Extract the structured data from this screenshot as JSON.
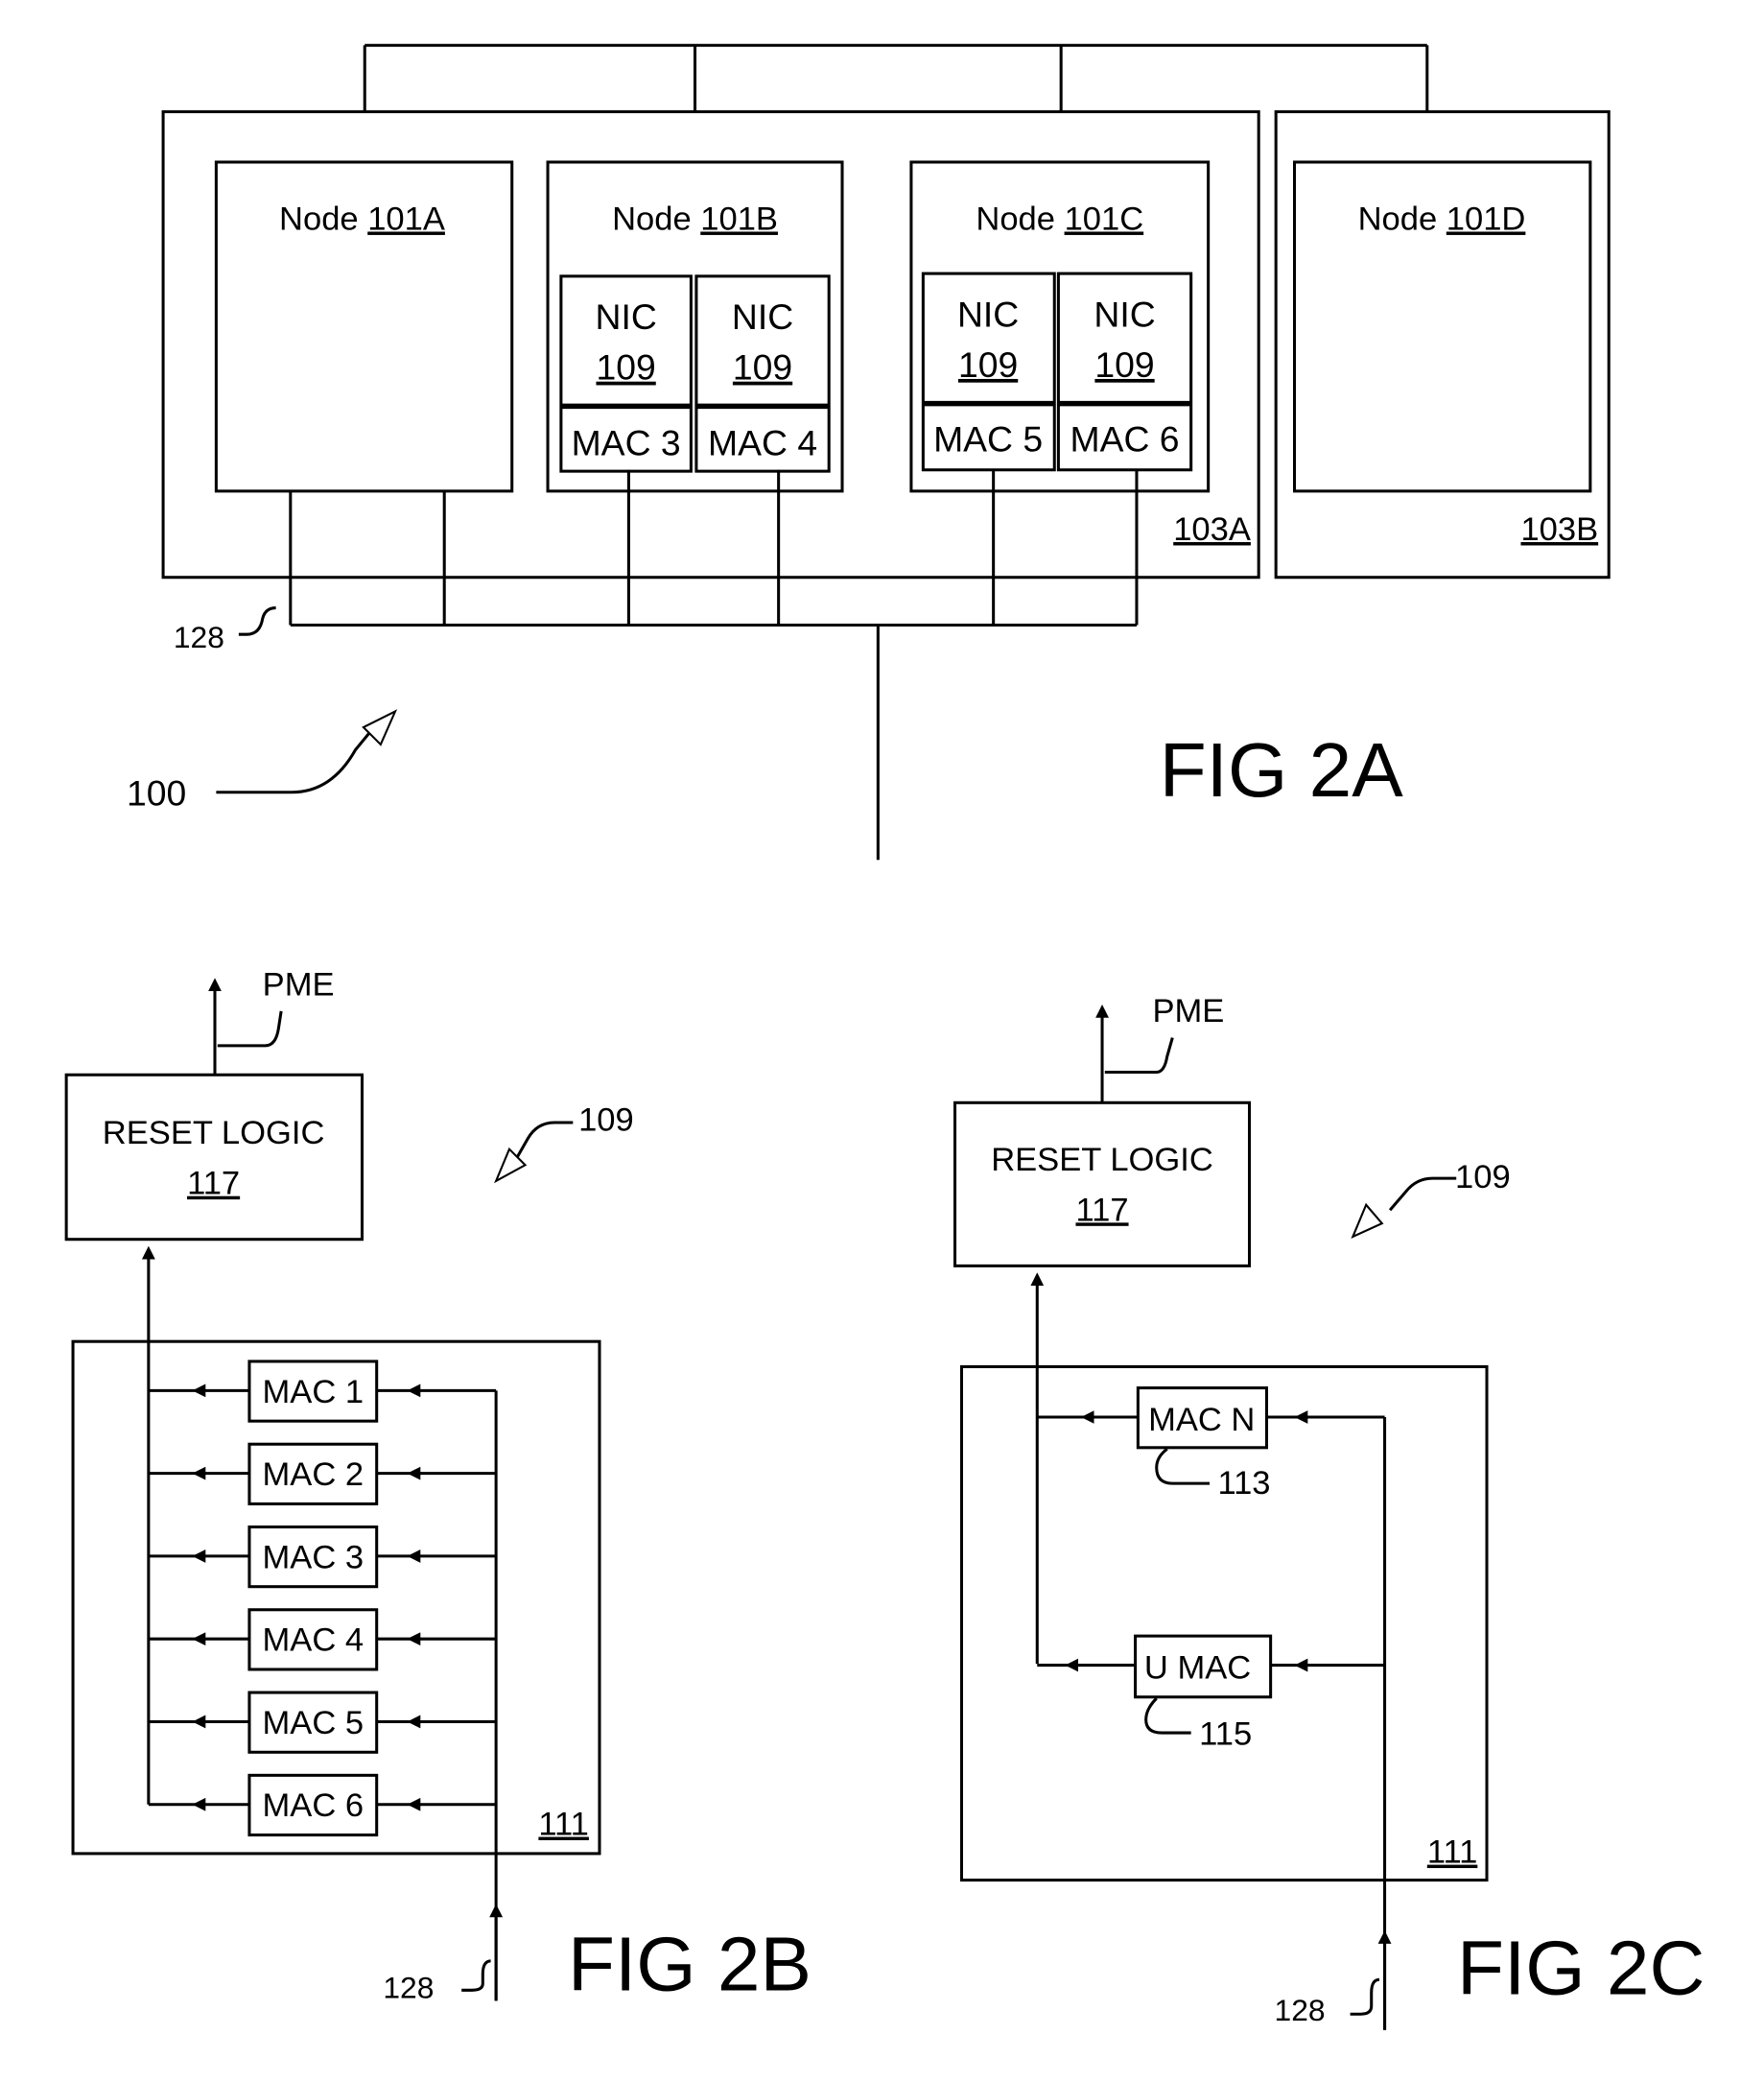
{
  "fig2a": {
    "title": "FIG 2A",
    "system_ref": "100",
    "bus_ref": "128",
    "enclosures": [
      {
        "label": "103A"
      },
      {
        "label": "103B"
      }
    ],
    "nodes": [
      {
        "prefix": "Node ",
        "ref": "101A"
      },
      {
        "prefix": "Node ",
        "ref": "101B"
      },
      {
        "prefix": "Node ",
        "ref": "101C"
      },
      {
        "prefix": "Node ",
        "ref": "101D"
      }
    ],
    "nics": [
      {
        "name": "NIC",
        "ref": "109",
        "mac": "MAC 3"
      },
      {
        "name": "NIC",
        "ref": "109",
        "mac": "MAC 4"
      },
      {
        "name": "NIC",
        "ref": "109",
        "mac": "MAC 5"
      },
      {
        "name": "NIC",
        "ref": "109",
        "mac": "MAC 6"
      }
    ]
  },
  "fig2b": {
    "title": "FIG 2B",
    "pme": "PME",
    "reset_logic": {
      "name": "RESET LOGIC",
      "ref": "117"
    },
    "nic_ref": "109",
    "container_ref": "111",
    "bus_ref": "128",
    "macs": [
      "MAC 1",
      "MAC 2",
      "MAC 3",
      "MAC 4",
      "MAC 5",
      "MAC 6"
    ]
  },
  "fig2c": {
    "title": "FIG 2C",
    "pme": "PME",
    "reset_logic": {
      "name": "RESET LOGIC",
      "ref": "117"
    },
    "nic_ref": "109",
    "container_ref": "111",
    "bus_ref": "128",
    "mac_n": {
      "name": "MAC N",
      "ref": "113"
    },
    "umac": {
      "name": "U MAC",
      "ref": "115"
    }
  }
}
